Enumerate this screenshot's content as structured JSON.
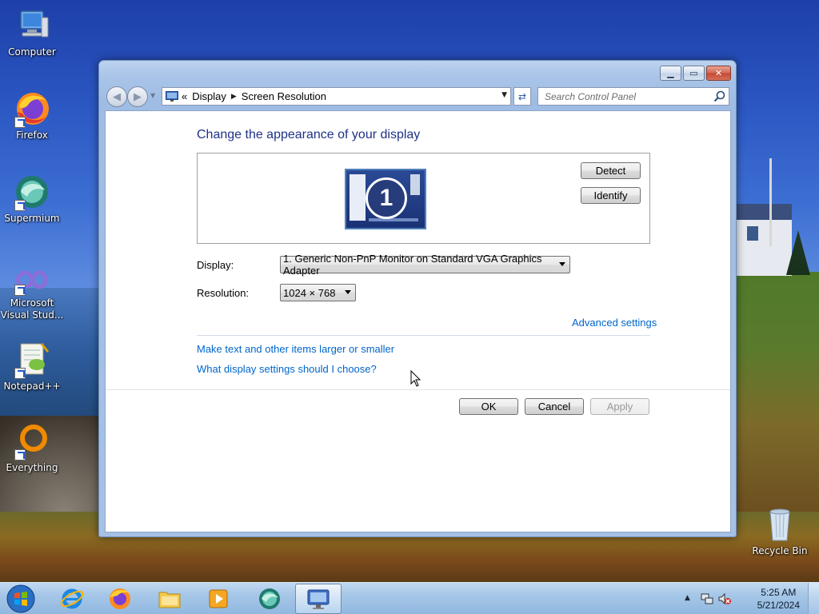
{
  "desktop": {
    "icons": [
      {
        "label": "Computer"
      },
      {
        "label": "Firefox"
      },
      {
        "label": "Supermium"
      },
      {
        "label": "Microsoft Visual Stud..."
      },
      {
        "label": "Notepad++"
      },
      {
        "label": "Everything"
      },
      {
        "label": "Recycle Bin"
      }
    ]
  },
  "window": {
    "breadcrumb": {
      "root_marker": "«",
      "items": [
        "Display",
        "Screen Resolution"
      ]
    },
    "search_placeholder": "Search Control Panel",
    "heading": "Change the appearance of your display",
    "monitor_number": "1",
    "detect_label": "Detect",
    "identify_label": "Identify",
    "display_label": "Display:",
    "display_value": "1. Generic Non-PnP Monitor on Standard VGA Graphics Adapter",
    "resolution_label": "Resolution:",
    "resolution_value": "1024 × 768",
    "advanced_link": "Advanced settings",
    "link_text_size": "Make text and other items larger or smaller",
    "link_help": "What display settings should I choose?",
    "ok_label": "OK",
    "cancel_label": "Cancel",
    "apply_label": "Apply"
  },
  "taskbar": {
    "clock_time": "5:25 AM",
    "clock_date": "5/21/2024"
  },
  "colors": {
    "heading": "#1e3287",
    "link": "#0066cc",
    "taskbar": "#a0c3e6"
  }
}
